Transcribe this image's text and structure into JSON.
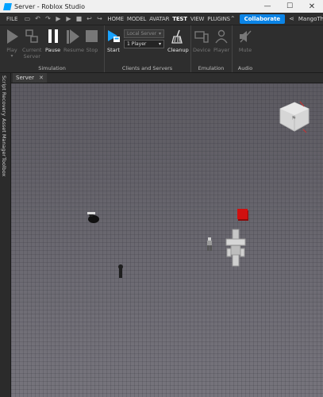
{
  "window": {
    "title": "Server - Roblox Studio",
    "minimize": "—",
    "maximize": "☐",
    "close": "✕"
  },
  "menu": {
    "file": "FILE",
    "quick_actions": [
      "save-icon",
      "undo-icon",
      "redo-icon",
      "play-icon",
      "run-icon",
      "stop-icon",
      "back-icon",
      "forward-icon"
    ],
    "tabs": [
      "HOME",
      "MODEL",
      "AVATAR",
      "TEST",
      "VIEW",
      "PLUGINS"
    ],
    "active_tab": "TEST",
    "collaborate": "Collaborate",
    "username": "MangoTheLeo"
  },
  "ribbon": {
    "simulation": {
      "label": "Simulation",
      "play": "Play",
      "current_server": "Current\nServer",
      "pause": "Pause",
      "resume": "Resume",
      "stop": "Stop"
    },
    "clients_servers": {
      "label": "Clients and Servers",
      "start": "Start",
      "server_select": "Local Server",
      "players_select": "1 Player",
      "cleanup": "Cleanup"
    },
    "emulation": {
      "label": "Emulation",
      "device": "Device",
      "player": "Player"
    },
    "audio": {
      "label": "Audio",
      "mute": "Mute"
    }
  },
  "left_dock": {
    "tabs": [
      "Script Recovery",
      "Asset Manager",
      "Toolbox"
    ]
  },
  "document": {
    "tab": "Server",
    "tab_close": "✕"
  },
  "viewport": {
    "colors": {
      "baseplate": "#6c6a72",
      "red_part": "#d01010",
      "gizmo": "#d9d9d9"
    }
  }
}
